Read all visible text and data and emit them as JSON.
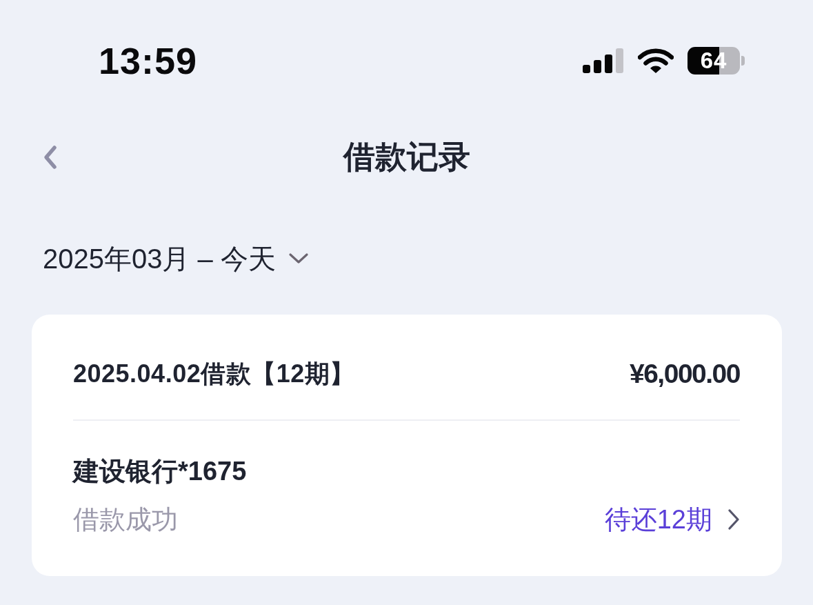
{
  "status_bar": {
    "time": "13:59",
    "battery": "64"
  },
  "nav": {
    "title": "借款记录"
  },
  "date_filter": {
    "label": "2025年03月 – 今天"
  },
  "loans": [
    {
      "title": "2025.04.02借款【12期】",
      "amount": "¥6,000.00",
      "bank": "建设银行*1675",
      "status": "借款成功",
      "pending": "待还12期"
    }
  ]
}
